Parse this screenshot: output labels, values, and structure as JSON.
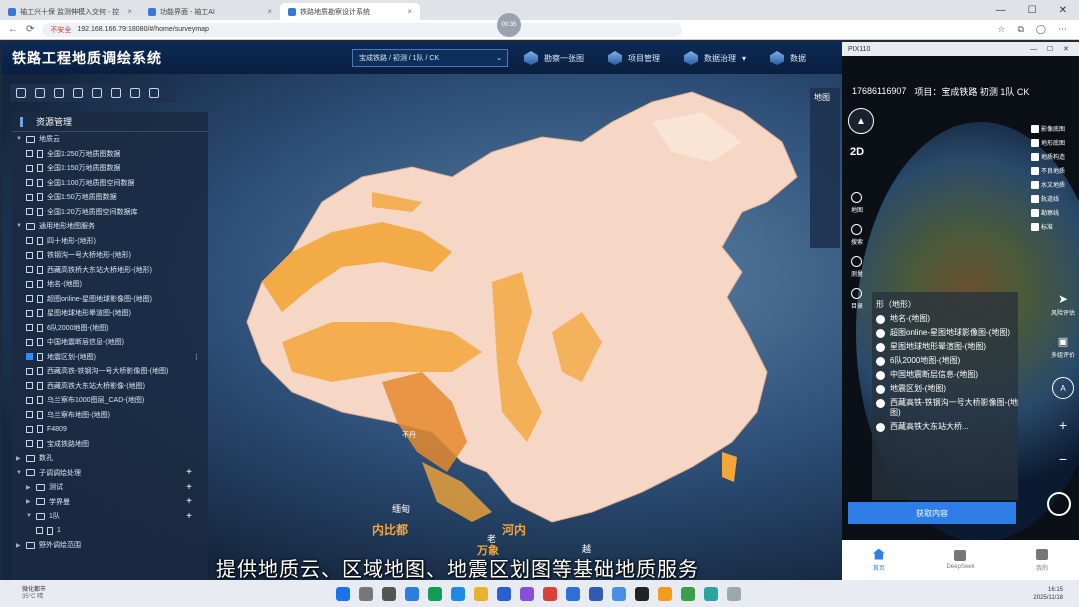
{
  "browser": {
    "tabs": [
      {
        "label": "袖工兴十保 监测伸模入交何 - 控",
        "active": false
      },
      {
        "label": "功能界面 - 袖工AI",
        "active": false
      },
      {
        "label": "铁路地质勘察设计系统",
        "active": true
      }
    ],
    "url": "192.168.166.79:18080/#/home/surveymap",
    "url_warning": "不安全",
    "timer": "00:35"
  },
  "app": {
    "title": "铁路工程地质调绘系统",
    "project_select": "宝成铁路 / 初测 / 1队 / CK",
    "menu": [
      {
        "label": "勘察一张图",
        "icon": "map-icon"
      },
      {
        "label": "项目管理",
        "icon": "project-icon"
      },
      {
        "label": "数据治理",
        "icon": "data-icon",
        "dropdown": true
      },
      {
        "label": "数据",
        "icon": "data2-icon"
      }
    ]
  },
  "resource_panel": {
    "title": "资源管理",
    "rows": [
      {
        "level": 0,
        "type": "folder",
        "label": "地质云",
        "expanded": true
      },
      {
        "level": 1,
        "type": "check",
        "checked": false,
        "label": "全国1:250万地质图数据"
      },
      {
        "level": 1,
        "type": "check",
        "checked": false,
        "label": "全国1:150万地质图数据"
      },
      {
        "level": 1,
        "type": "check",
        "checked": false,
        "label": "全国1:100万地质图空间数据"
      },
      {
        "level": 1,
        "type": "check",
        "checked": false,
        "label": "全国1:50万地质图数据"
      },
      {
        "level": 1,
        "type": "check",
        "checked": false,
        "label": "全国1:20万地质图空间数据库"
      },
      {
        "level": 0,
        "type": "folder",
        "label": "通用地形地图服务",
        "expanded": true
      },
      {
        "level": 1,
        "type": "check",
        "checked": false,
        "label": "四十地形-(地形)"
      },
      {
        "level": 1,
        "type": "check",
        "checked": false,
        "label": "铁钢沟一号大桥地形-(地形)"
      },
      {
        "level": 1,
        "type": "check",
        "checked": false,
        "label": "西藏高铁桥大东站大桥地形-(地形)"
      },
      {
        "level": 1,
        "type": "check",
        "checked": false,
        "label": "地名-(地图)"
      },
      {
        "level": 1,
        "type": "check",
        "checked": false,
        "label": "超图online-星图地球影像图-(地图)"
      },
      {
        "level": 1,
        "type": "check",
        "checked": false,
        "label": "星图地球地形晕渲图-(地图)"
      },
      {
        "level": 1,
        "type": "check",
        "checked": false,
        "label": "6队2000地图-(地图)"
      },
      {
        "level": 1,
        "type": "check",
        "checked": false,
        "label": "中国地震断层信息-(地图)"
      },
      {
        "level": 1,
        "type": "check",
        "checked": true,
        "label": "地震区划-(地图)",
        "menu": true
      },
      {
        "level": 1,
        "type": "check",
        "checked": false,
        "label": "西藏高铁-铁钢沟一号大桥影像图-(地图)"
      },
      {
        "level": 1,
        "type": "check",
        "checked": false,
        "label": "西藏高铁大东站大桥影像-(地图)"
      },
      {
        "level": 1,
        "type": "check",
        "checked": false,
        "label": "乌兰察布1000图层_CAD-(地图)"
      },
      {
        "level": 1,
        "type": "check",
        "checked": false,
        "label": "乌兰察布地图-(地图)"
      },
      {
        "level": 1,
        "type": "check",
        "checked": false,
        "label": "F4809"
      },
      {
        "level": 1,
        "type": "check",
        "checked": false,
        "label": "宝成铁路地图"
      },
      {
        "level": 0,
        "type": "folder",
        "label": "数孔",
        "expanded": false
      },
      {
        "level": 0,
        "type": "folder",
        "label": "子调调绘处理",
        "expanded": true,
        "plus": true
      },
      {
        "level": 1,
        "type": "folder",
        "label": "测试",
        "expanded": false,
        "plus": true
      },
      {
        "level": 1,
        "type": "folder",
        "label": "学界曼",
        "expanded": false,
        "plus": true
      },
      {
        "level": 1,
        "type": "folder",
        "label": "1队",
        "expanded": true,
        "plus": true
      },
      {
        "level": 2,
        "type": "file",
        "label": "1",
        "checked": false
      },
      {
        "level": 0,
        "type": "folder",
        "label": "野外调绘范围",
        "expanded": false
      }
    ]
  },
  "map_labels": {
    "city1": "内比都",
    "city2": "河内",
    "city3": "万象",
    "city4": "老",
    "city5": "越",
    "city6": "缅甸",
    "city7": "不丹"
  },
  "side_tab_label": "地图",
  "caption": "提供地质云、区域地图、地震区划图等基础地质服务",
  "phone": {
    "window_title": "PIX110",
    "phone_number": "17686116907",
    "project_label": "项目：",
    "project_value": "宝成铁路 初测 1队 CK",
    "mode": "2D",
    "left_tools": [
      "地图",
      "搜索",
      "测量",
      "目录"
    ],
    "right_tools": [
      "影像底图",
      "地形底图",
      "地质构造",
      "不良地质",
      "水文地质",
      "轨道线",
      "勘察线",
      "标准"
    ],
    "right_lower": [
      "风险评估",
      "多组评价"
    ],
    "layer_popup_header": "形（地形）",
    "layer_popup_items": [
      "地名-(地图)",
      "超图online-星图地球影像图-(地图)",
      "星图地球地形晕渲图-(地图)",
      "6队2000地图-(地图)",
      "中国地震断层信息-(地图)",
      "地震区划-(地图)",
      "西藏高铁-铁钢沟一号大桥影像图-(地图)",
      "西藏高铁大东站大桥..."
    ],
    "button": "获取内容",
    "tabs": [
      {
        "label": "首页",
        "active": true
      },
      {
        "label": "DeepSeek",
        "active": false
      },
      {
        "label": "我的",
        "active": false
      }
    ]
  },
  "taskbar": {
    "weather_line1": "微化都市",
    "weather_line2": "35°C 晴",
    "time": "16:15",
    "date": "2025/11/18"
  }
}
